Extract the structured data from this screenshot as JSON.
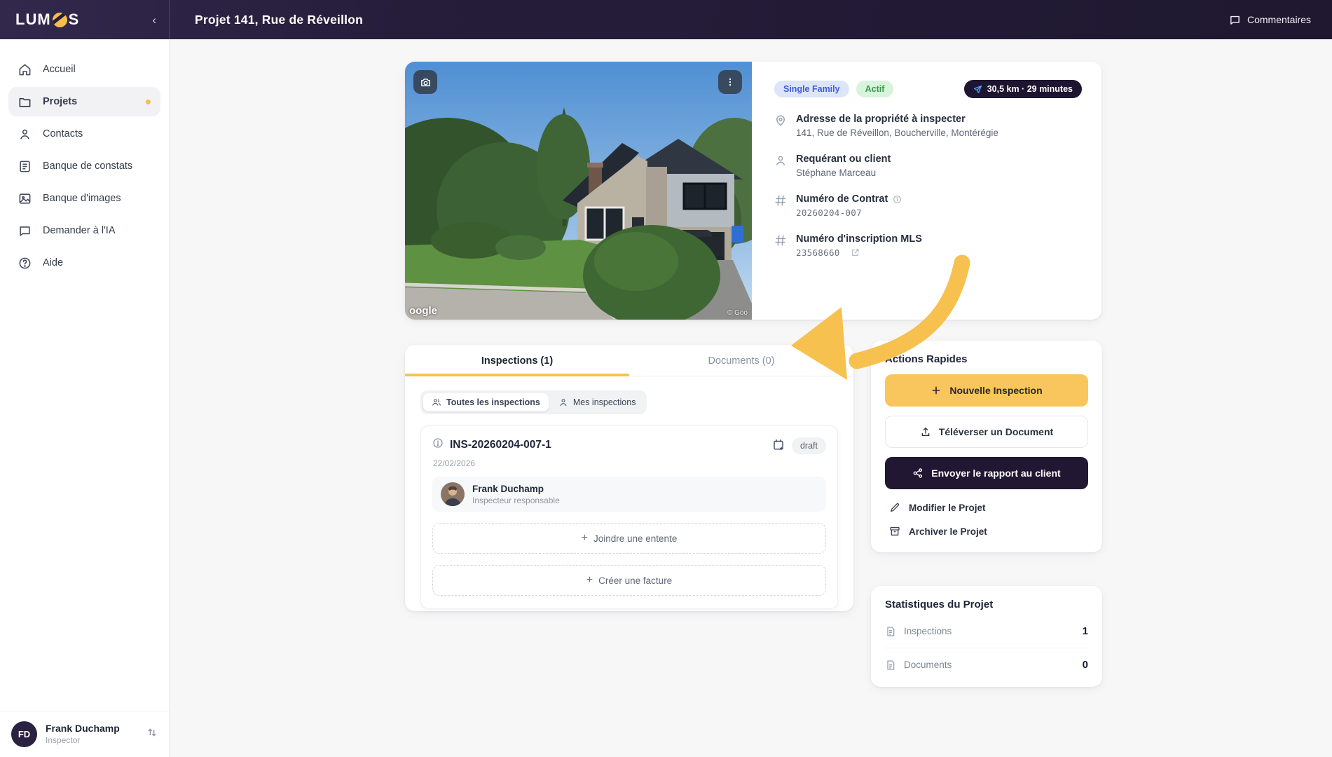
{
  "brand": {
    "logo_prefix": "LUM",
    "logo_suffix": "S"
  },
  "header": {
    "title": "Projet 141, Rue de Réveillon",
    "comments_label": "Commentaires",
    "collapse_icon": "‹"
  },
  "sidebar": {
    "items": [
      {
        "label": "Accueil",
        "icon": "home-icon"
      },
      {
        "label": "Projets",
        "icon": "folder-icon",
        "active": true
      },
      {
        "label": "Contacts",
        "icon": "person-icon"
      },
      {
        "label": "Banque de constats",
        "icon": "notes-icon"
      },
      {
        "label": "Banque d'images",
        "icon": "image-icon"
      },
      {
        "label": "Demander à l'IA",
        "icon": "chat-icon"
      },
      {
        "label": "Aide",
        "icon": "help-icon"
      }
    ],
    "user": {
      "initials": "FD",
      "name": "Frank Duchamp",
      "role": "Inspector"
    }
  },
  "property": {
    "badges": {
      "type": "Single Family",
      "status": "Actif"
    },
    "distance_badge": "30,5 km · 29 minutes",
    "fields": [
      {
        "label": "Adresse de la propriété à inspecter",
        "value": "141, Rue de Réveillon, Boucherville, Montérégie"
      },
      {
        "label": "Requérant ou client",
        "value": "Stéphane Marceau"
      },
      {
        "label": "Numéro de Contrat",
        "value": "20260204-007"
      },
      {
        "label": "Numéro d'inscription MLS",
        "value": "23568660"
      }
    ],
    "watermark_left": "oogle",
    "watermark_right": "© Goo"
  },
  "tabs": {
    "inspections": "Inspections (1)",
    "documents": "Documents (0)"
  },
  "filters": {
    "all": "Toutes les inspections",
    "mine": "Mes inspections"
  },
  "inspection": {
    "id": "INS-20260204-007-1",
    "date": "22/02/2026",
    "status": "draft",
    "inspector_name": "Frank Duchamp",
    "inspector_role": "Inspecteur responsable",
    "attach_agreement": "Joindre une entente",
    "create_invoice": "Créer une facture",
    "plus": "+"
  },
  "quick_actions": {
    "title": "Actions Rapides",
    "new_inspection": "Nouvelle Inspection",
    "upload_document": "Téléverser un Document",
    "send_report": "Envoyer le rapport au client",
    "edit_project": "Modifier le Projet",
    "archive_project": "Archiver le Projet"
  },
  "stats": {
    "title": "Statistiques du Projet",
    "rows": [
      {
        "label": "Inspections",
        "value": "1"
      },
      {
        "label": "Documents",
        "value": "0"
      }
    ]
  },
  "colors": {
    "accent_yellow": "#F6C24F",
    "header_purple": "#261D3B",
    "dark_button": "#211733",
    "badge_blue_text": "#3F5BD9",
    "badge_green_text": "#2F9E44"
  }
}
